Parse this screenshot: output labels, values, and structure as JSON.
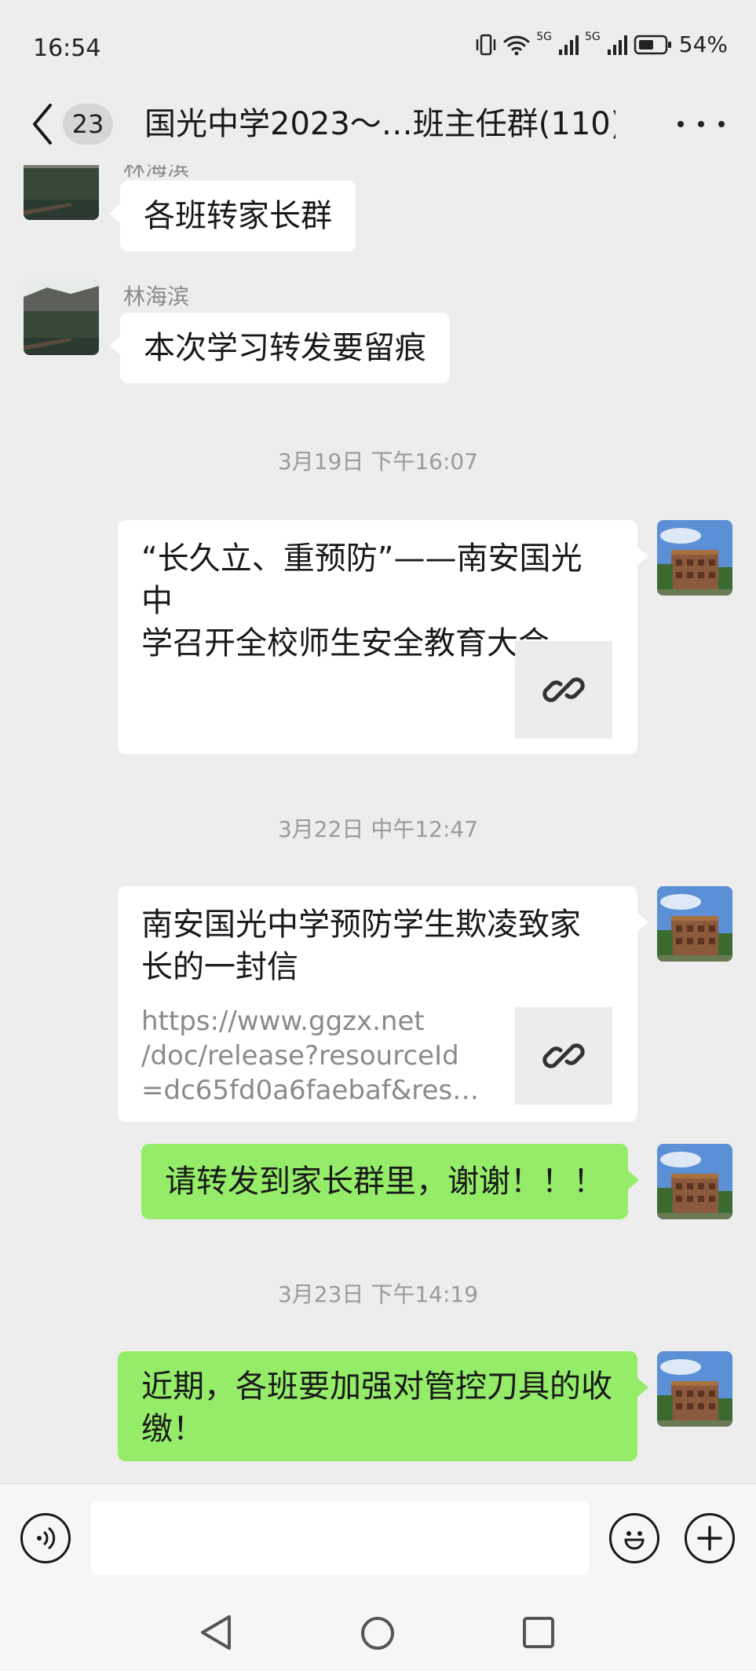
{
  "status_bar": {
    "time": "16:54",
    "network_1": "5G",
    "network_2": "5G",
    "battery": "54%"
  },
  "header": {
    "unread_count": "23",
    "title": "国光中学2023～…班主任群(110)"
  },
  "messages": [
    {
      "sender": "林海滨",
      "text": "各班转家长群"
    },
    {
      "sender": "林海滨",
      "text": "本次学习转发要留痕"
    }
  ],
  "timestamps": [
    "3月19日 下午16:07",
    "3月22日 中午12:47",
    "3月23日 下午14:19"
  ],
  "link_cards": [
    {
      "title_line_1": "“长久立、重预防”——南安国光中",
      "title_line_2": "学召开全校师生安全教育大会"
    },
    {
      "title_line_1": "南安国光中学预防学生欺凌致家",
      "title_line_2": "长的一封信",
      "url_line_1": "https://www.ggzx.net",
      "url_line_2": "/doc/release?resourceId",
      "url_line_3": "=dc65fd0a6faebaf&resourc…"
    }
  ],
  "own_messages": [
    {
      "text": "请转发到家长群里，谢谢！！！"
    },
    {
      "text_line_1": "近期，各班要加强对管控刀具的收",
      "text_line_2": "缴！"
    }
  ],
  "colors": {
    "background": "#ededed",
    "own_bubble": "#95ec69",
    "other_bubble": "#ffffff"
  },
  "icons": {
    "back": "chevron-left-icon",
    "more": "more-dots-icon",
    "link": "link-chain-icon",
    "voice": "voice-icon",
    "emoji": "emoji-icon",
    "add": "plus-icon"
  }
}
